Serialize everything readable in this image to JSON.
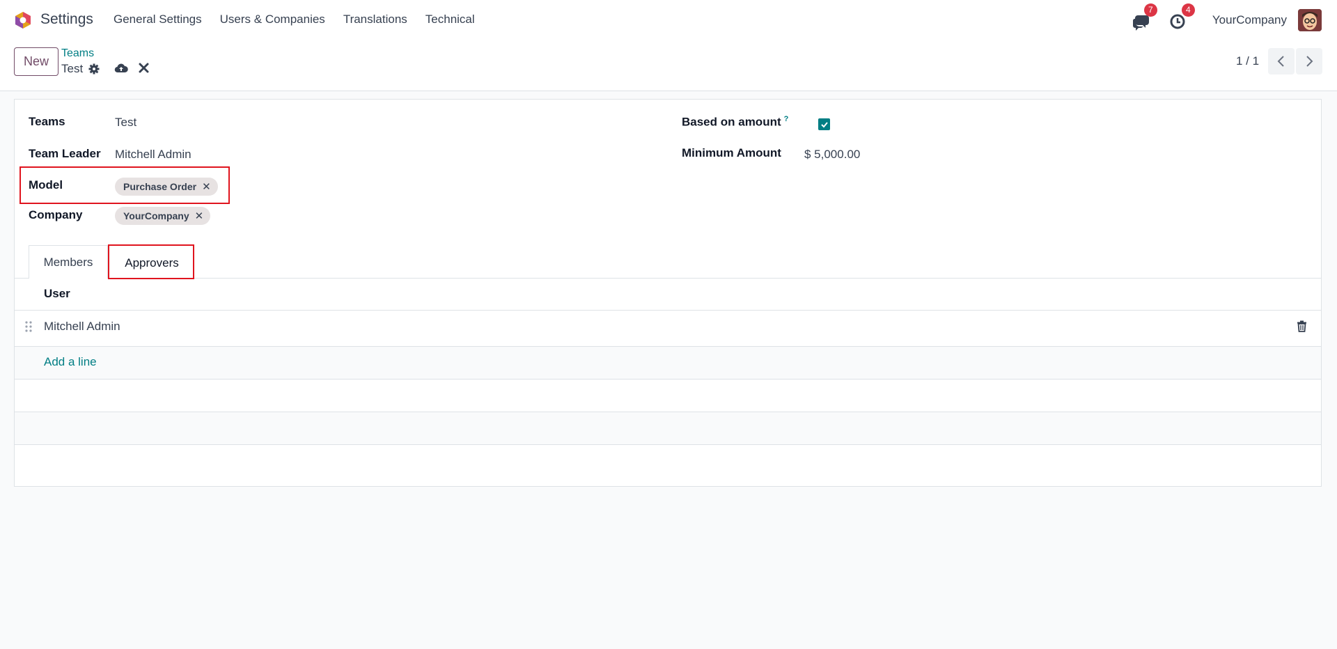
{
  "navbar": {
    "app_title": "Settings",
    "menu": [
      "General Settings",
      "Users & Companies",
      "Translations",
      "Technical"
    ],
    "messages_count": "7",
    "activities_count": "4",
    "company": "YourCompany"
  },
  "control_panel": {
    "new_label": "New",
    "breadcrumb_parent": "Teams",
    "breadcrumb_current": "Test",
    "pager": "1 / 1"
  },
  "form": {
    "teams_label": "Teams",
    "teams_value": "Test",
    "team_leader_label": "Team Leader",
    "team_leader_value": "Mitchell Admin",
    "model_label": "Model",
    "model_tag": "Purchase Order",
    "company_label": "Company",
    "company_tag": "YourCompany",
    "based_on_amount_label": "Based on amount",
    "help_mark": "?",
    "based_on_amount_checked": true,
    "minimum_amount_label": "Minimum Amount",
    "minimum_amount_value": "$ 5,000.00"
  },
  "tabs": {
    "members": "Members",
    "approvers": "Approvers",
    "active": "Approvers"
  },
  "table": {
    "header_user": "User",
    "rows": [
      {
        "user": "Mitchell Admin"
      }
    ],
    "add_line": "Add a line"
  },
  "colors": {
    "accent": "#017e84",
    "brand": "#714b67",
    "badge": "#dc3545",
    "highlight": "#e0141e"
  }
}
